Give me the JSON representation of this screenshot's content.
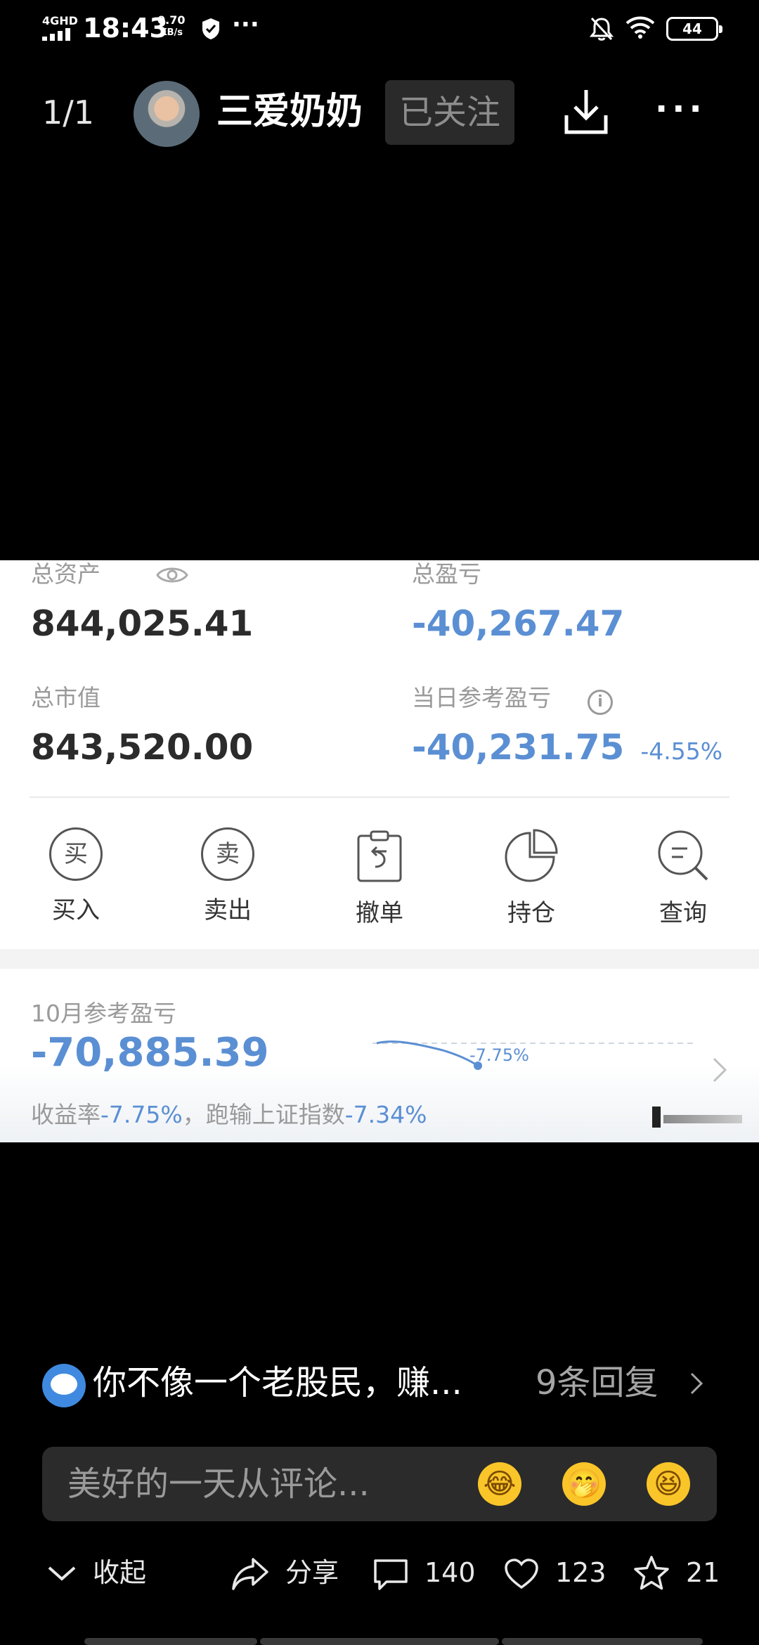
{
  "status_bar": {
    "network": "4GHD",
    "time": "18:43",
    "speed_value": "0.70",
    "speed_unit": "KB/s",
    "more": "···",
    "battery": "44"
  },
  "header": {
    "page_counter": "1/1",
    "username": "三爱奶奶",
    "follow_label": "已关注",
    "more": "···"
  },
  "card": {
    "total_assets_label": "总资产",
    "total_assets_value": "844,025.41",
    "total_pl_label": "总盈亏",
    "total_pl_value": "-40,267.47",
    "market_value_label": "总市值",
    "market_value_value": "843,520.00",
    "daily_pl_label": "当日参考盈亏",
    "daily_pl_value": "-40,231.75",
    "daily_pl_pct": "-4.55%",
    "actions": [
      {
        "label": "买入",
        "glyph": "买",
        "icon": "buy-icon"
      },
      {
        "label": "卖出",
        "glyph": "卖",
        "icon": "sell-icon"
      },
      {
        "label": "撤单",
        "icon": "cancel-order-icon"
      },
      {
        "label": "持仓",
        "icon": "pie-chart-icon"
      },
      {
        "label": "查询",
        "icon": "search-icon"
      }
    ],
    "monthly": {
      "label": "10月参考盈亏",
      "value": "-70,885.39",
      "chart_pct": "-7.75%",
      "summary_prefix": "收益率",
      "summary_rate": "-7.75%",
      "summary_mid": "，跑输上证指数",
      "summary_index": "-7.34%"
    }
  },
  "comment": {
    "text": "你不像一个老股民，赚...",
    "replies": "9条回复"
  },
  "input": {
    "placeholder": "美好的一天从评论..."
  },
  "bottom_bar": {
    "collapse_label": "收起",
    "share_label": "分享",
    "comments_count": "140",
    "likes_count": "123",
    "favorites_count": "21"
  },
  "colors": {
    "accent_blue": "#5b8fd3",
    "background": "#000000",
    "card": "#ffffff"
  }
}
